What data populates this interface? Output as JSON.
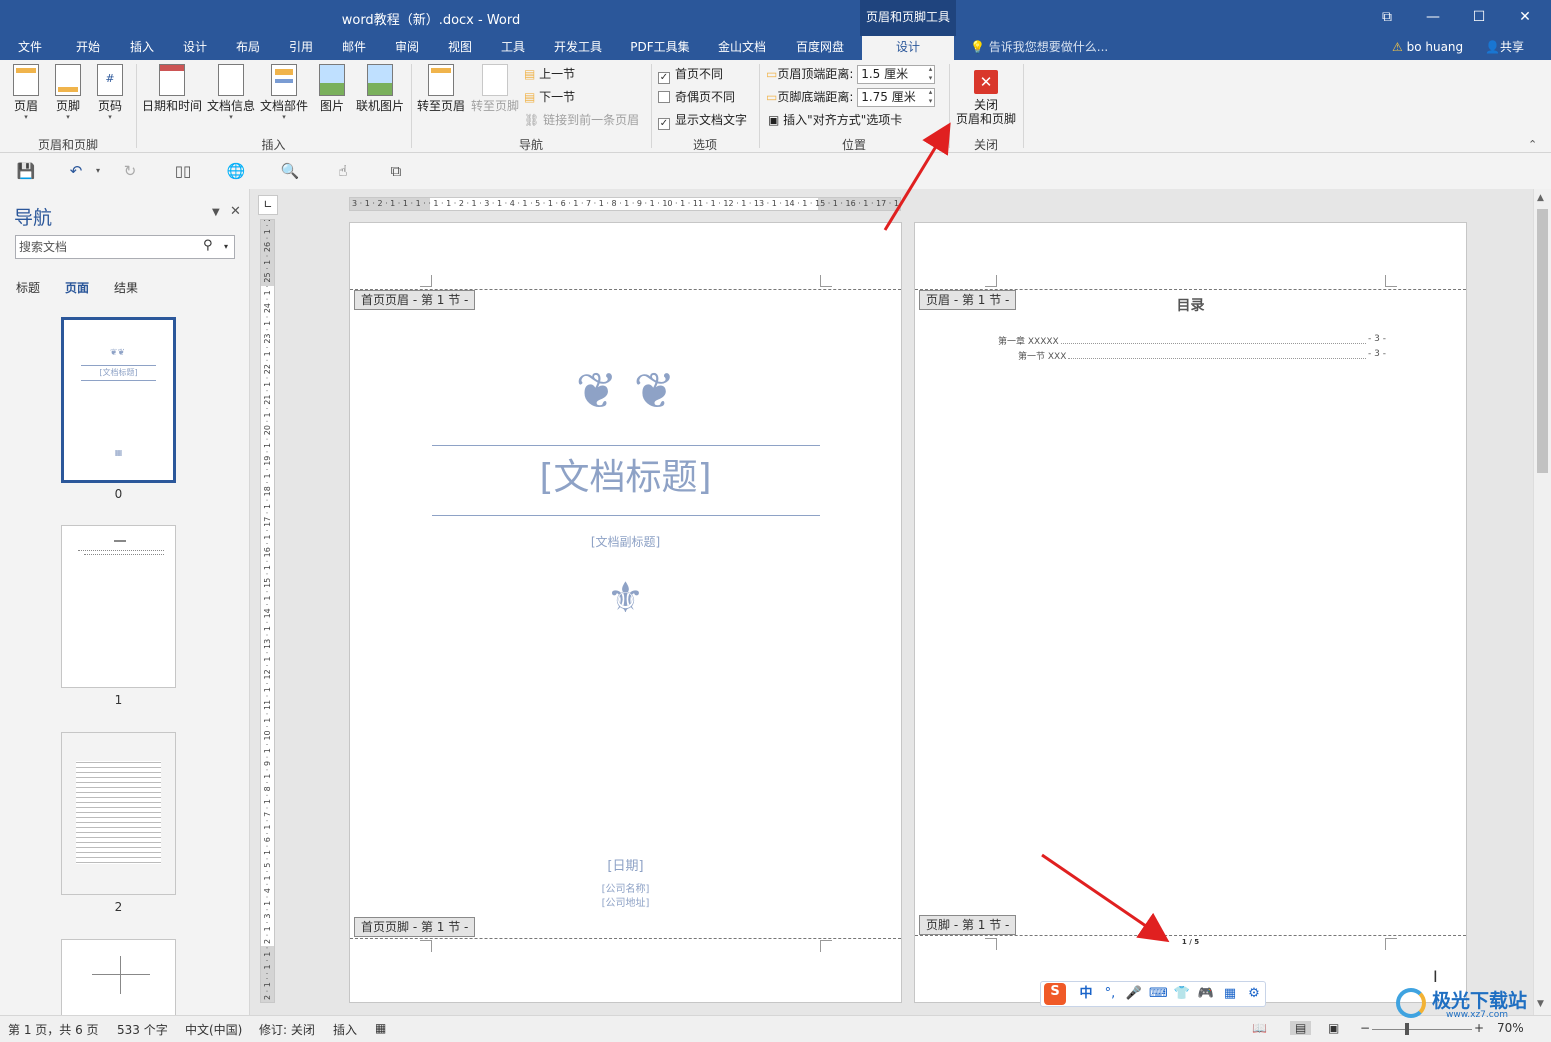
{
  "window": {
    "title": "word教程（新）.docx - Word",
    "context_tool": "页眉和页脚工具",
    "controls": {
      "restore_ribbon": "⧉",
      "minimize": "—",
      "maximize": "☐",
      "close": "✕"
    }
  },
  "menu": {
    "tabs": [
      "文件",
      "开始",
      "插入",
      "设计",
      "布局",
      "引用",
      "邮件",
      "审阅",
      "视图",
      "工具",
      "开发工具",
      "PDF工具集",
      "金山文档",
      "百度网盘",
      "设计"
    ],
    "active_index": 14,
    "tell_me": "告诉我您想要做什么...",
    "user": "bo huang",
    "share": "共享"
  },
  "ribbon": {
    "groups": {
      "hf": "页眉和页脚",
      "insert": "插入",
      "nav": "导航",
      "options": "选项",
      "position": "位置",
      "close": "关闭"
    },
    "hf_buttons": [
      "页眉",
      "页脚",
      "页码"
    ],
    "insert_buttons": [
      "日期和时间",
      "文档信息",
      "文档部件",
      "图片",
      "联机图片"
    ],
    "nav_buttons": {
      "goto_header": "转至页眉",
      "goto_footer": "转至页脚",
      "prev": "上一节",
      "next": "下一节",
      "link_prev": "链接到前一条页眉"
    },
    "options": {
      "diff_first": "首页不同",
      "diff_odd_even": "奇偶页不同",
      "show_text": "显示文档文字",
      "diff_first_checked": true,
      "diff_odd_even_checked": false,
      "show_text_checked": true
    },
    "position": {
      "header_dist_label": "页眉顶端距离:",
      "header_dist": "1.5 厘米",
      "footer_dist_label": "页脚底端距离:",
      "footer_dist": "1.75 厘米",
      "insert_align": "插入\"对齐方式\"选项卡"
    },
    "close_button": {
      "line1": "关闭",
      "line2": "页眉和页脚"
    }
  },
  "nav_pane": {
    "title": "导航",
    "search_placeholder": "搜索文档",
    "tabs": [
      "标题",
      "页面",
      "结果"
    ],
    "active_tab": 1,
    "page_numbers": [
      "0",
      "1",
      "2"
    ],
    "thumb0_title": "[文档标题]"
  },
  "rulers": {
    "horizontal": "3 · 1 · 2 · 1 · 1 · 1 · · 1 · 1 · 2 · 1 · 3 · 1 · 4 · 1 · 5 · 1 · 6 · 1 · 7 · 1 · 8 · 1 · 9 · 1 · 10 · 1 · 11 · 1 · 12 · 1 · 13 · 1 · 14 · 1 · 15 · 1 · 16 · 1 · 17 · 1",
    "vertical": "2 · 1 · · 1 · 1 · 2 · 1 · 3 · 1 · 4 · 1 · 5 · 1 · 6 · 1 · 7 · 1 · 8 · 1 · 9 · 1 · 10 · 1 · 11 · 1 · 12 · 1 · 13 · 1 · 14 · 1 · 15 · 1 · 16 · 1 · 17 · 1 · 18 · 1 · 19 · 1 · 20 · 1 · 21 · 1 · 22 · 1 · 23 · 1 · 24 · 1 · 25 · 1 · 26 · 1 · 27"
  },
  "page1": {
    "header_tag": "首页页眉 - 第 1 节 -",
    "footer_tag": "首页页脚 - 第 1 节 -",
    "title": "[文档标题]",
    "subtitle": "[文档副标题]",
    "date": "[日期]",
    "company": "[公司名称]",
    "address": "[公司地址]"
  },
  "page2": {
    "header_tag": "页眉 - 第 1 节 -",
    "footer_tag": "页脚 - 第 1 节 -",
    "toc_title": "目录",
    "toc": [
      {
        "text": "第一章 XXXXX",
        "page": "- 3 -"
      },
      {
        "text": "第一节 XXX",
        "page": "- 3 -"
      }
    ],
    "page_number": "1 / 5"
  },
  "status": {
    "page": "第 1 页，共 6 页",
    "words": "533 个字",
    "lang": "中文(中国)",
    "track": "修订: 关闭",
    "insert": "插入",
    "zoom": "70%"
  },
  "ime": {
    "lang": "中",
    "punct": "°,"
  },
  "watermark": {
    "text": "极光下载站",
    "url": "www.xz7.com"
  },
  "colors": {
    "brand": "#2b579a",
    "arrow": "#e02020",
    "placeholder": "#8ea2c6"
  }
}
